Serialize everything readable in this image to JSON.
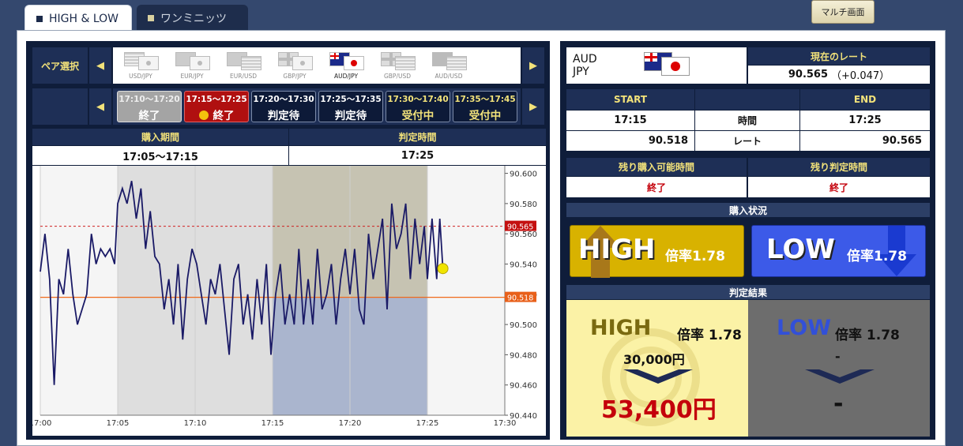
{
  "tabs": [
    {
      "label": "HIGH & LOW"
    },
    {
      "label": "ワンミニッツ"
    }
  ],
  "multi_screen_label": "マルチ画面",
  "pair_select": {
    "label": "ペア選択",
    "pairs": [
      {
        "label": "USD/JPY",
        "selected": false
      },
      {
        "label": "EUR/JPY",
        "selected": false
      },
      {
        "label": "EUR/USD",
        "selected": false
      },
      {
        "label": "GBP/JPY",
        "selected": false
      },
      {
        "label": "AUD/JPY",
        "selected": true
      },
      {
        "label": "GBP/USD",
        "selected": false
      },
      {
        "label": "AUD/USD",
        "selected": false
      }
    ]
  },
  "time_slots": [
    {
      "time": "17:10〜17:20",
      "status": "終了",
      "state": "ended-gray"
    },
    {
      "time": "17:15〜17:25",
      "status": "終了",
      "state": "ended-red"
    },
    {
      "time": "17:20〜17:30",
      "status": "判定待",
      "state": "pending"
    },
    {
      "time": "17:25〜17:35",
      "status": "判定待",
      "state": "pending"
    },
    {
      "time": "17:30〜17:40",
      "status": "受付中",
      "state": "open"
    },
    {
      "time": "17:35〜17:45",
      "status": "受付中",
      "state": "open"
    }
  ],
  "period": {
    "purchase_label": "購入期間",
    "purchase_value": "17:05〜17:15",
    "judge_label": "判定時間",
    "judge_value": "17:25"
  },
  "chart_data": {
    "type": "line",
    "x_ticks": [
      "17:00",
      "17:05",
      "17:10",
      "17:15",
      "17:20",
      "17:25",
      "17:30"
    ],
    "y_ticks": [
      "90.600",
      "90.580",
      "90.560",
      "90.540",
      "90.520",
      "90.500",
      "90.480",
      "90.460",
      "90.440"
    ],
    "ylim": [
      90.44,
      90.605
    ],
    "xlim_minutes": [
      0,
      30
    ],
    "current_rate_marker": "90.565",
    "start_rate_marker": "90.518",
    "purchase_period_minutes": [
      5,
      15
    ],
    "judge_period_minutes": [
      15,
      25
    ],
    "series": [
      {
        "x": [
          0,
          0.3,
          0.6,
          0.9,
          1.2,
          1.5,
          1.8,
          2.1,
          2.4,
          2.7,
          3.0,
          3.3,
          3.6,
          3.9,
          4.2,
          4.5,
          4.8,
          5.0,
          5.3,
          5.6,
          5.9,
          6.2,
          6.5,
          6.8,
          7.1,
          7.4,
          7.7,
          8.0,
          8.3,
          8.6,
          8.9,
          9.2,
          9.5,
          9.8,
          10.1,
          10.4,
          10.7,
          11.0,
          11.3,
          11.6,
          11.9,
          12.2,
          12.5,
          12.8,
          13.1,
          13.4,
          13.7,
          14.0,
          14.3,
          14.6,
          14.9,
          15.2,
          15.5,
          15.8,
          16.1,
          16.4,
          16.7,
          17.0,
          17.3,
          17.6,
          17.9,
          18.2,
          18.5,
          18.8,
          19.1,
          19.4,
          19.7,
          20.0,
          20.3,
          20.6,
          20.9,
          21.2,
          21.5,
          21.8,
          22.1,
          22.4,
          22.7,
          23.0,
          23.3,
          23.6,
          23.9,
          24.2,
          24.5,
          24.8,
          25.0,
          25.3,
          25.6,
          25.8,
          26.0
        ],
        "y": [
          90.535,
          90.56,
          90.53,
          90.46,
          90.53,
          90.52,
          90.55,
          90.52,
          90.5,
          90.51,
          90.52,
          90.56,
          90.54,
          90.55,
          90.545,
          90.55,
          90.54,
          90.58,
          90.59,
          90.58,
          90.595,
          90.57,
          90.59,
          90.55,
          90.575,
          90.545,
          90.54,
          90.51,
          90.53,
          90.5,
          90.54,
          90.49,
          90.53,
          90.55,
          90.54,
          90.52,
          90.5,
          90.53,
          90.52,
          90.54,
          90.51,
          90.48,
          90.53,
          90.54,
          90.5,
          90.52,
          90.49,
          90.53,
          90.5,
          90.54,
          90.48,
          90.52,
          90.54,
          90.5,
          90.52,
          90.5,
          90.55,
          90.5,
          90.53,
          90.5,
          90.55,
          90.51,
          90.52,
          90.54,
          90.5,
          90.53,
          90.55,
          90.52,
          90.55,
          90.51,
          90.5,
          90.56,
          90.53,
          90.55,
          90.57,
          90.51,
          90.58,
          90.55,
          90.56,
          90.58,
          90.53,
          90.57,
          90.54,
          90.565,
          90.53,
          90.57,
          90.53,
          90.57,
          90.537
        ]
      }
    ]
  },
  "rate": {
    "pair_base": "AUD",
    "pair_quote": "JPY",
    "current_label": "現在のレート",
    "current_value": "90.565",
    "current_change": "（+0.047）"
  },
  "summary": {
    "start_label": "START",
    "end_label": "END",
    "time_label": "時間",
    "rate_label": "レート",
    "start_time": "17:15",
    "end_time": "17:25",
    "start_rate": "90.518",
    "end_rate": "90.565"
  },
  "remaining": {
    "purchase_label": "残り購入可能時間",
    "purchase_value": "終了",
    "judge_label": "残り判定時間",
    "judge_value": "終了"
  },
  "purchase_status": {
    "label": "購入状況",
    "high_label": "HIGH",
    "high_rate": "倍率1.78",
    "low_label": "LOW",
    "low_rate": "倍率1.78"
  },
  "result": {
    "label": "判定結果",
    "high_title": "HIGH",
    "high_rate": "倍率 1.78",
    "high_amount": "30,000円",
    "high_payout": "53,400円",
    "low_title": "LOW",
    "low_rate": "倍率 1.78",
    "low_amount": "-",
    "low_payout": "-"
  },
  "colors": {
    "navy": "#0f1d3a",
    "header_yellow": "#f2e27a",
    "high_btn": "#d8b200",
    "low_btn": "#3c5ae8",
    "payout_red": "#c4000b",
    "line": "#1a1a66"
  }
}
